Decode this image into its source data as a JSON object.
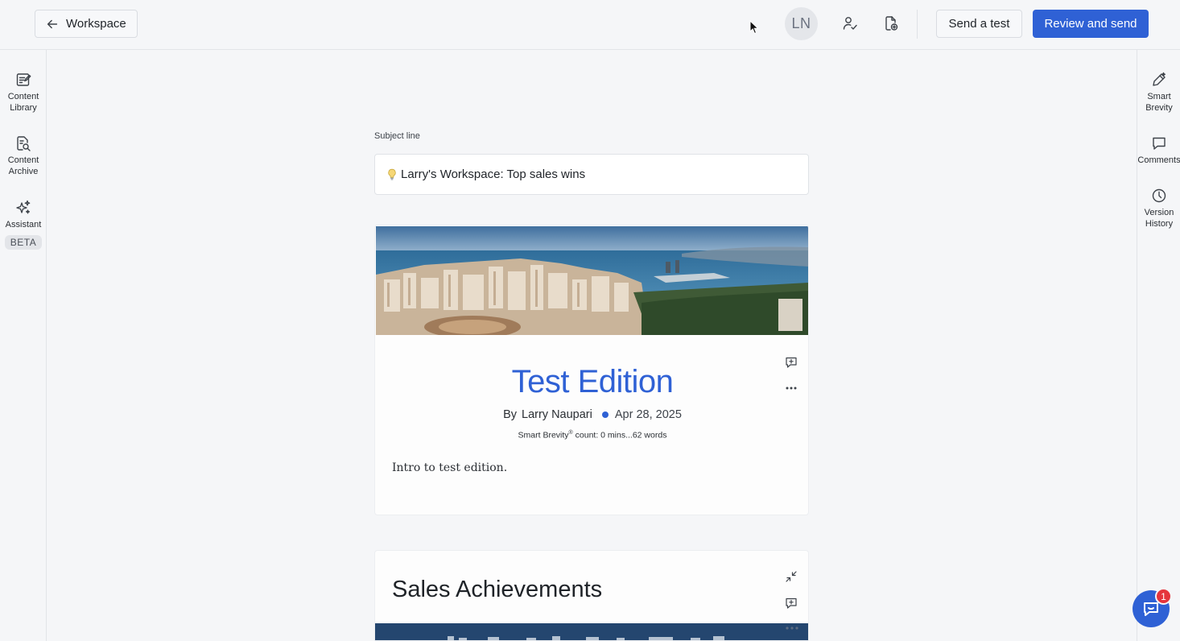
{
  "topbar": {
    "back_label": "Workspace",
    "avatar_initials": "LN",
    "send_test_label": "Send a test",
    "review_send_label": "Review and send"
  },
  "left_sidebar": {
    "items": [
      {
        "label_line1": "Content",
        "label_line2": "Library",
        "icon": "content-library-icon"
      },
      {
        "label_line1": "Content",
        "label_line2": "Archive",
        "icon": "content-archive-icon"
      },
      {
        "label_line1": "Assistant",
        "badge": "BETA",
        "icon": "sparkle-icon"
      }
    ]
  },
  "right_sidebar": {
    "items": [
      {
        "label_line1": "Smart",
        "label_line2": "Brevity",
        "icon": "pen-icon"
      },
      {
        "label_line1": "Comments",
        "icon": "comment-icon"
      },
      {
        "label_line1": "Version",
        "label_line2": "History",
        "icon": "clock-icon"
      }
    ]
  },
  "editor": {
    "subject_label": "Subject line",
    "subject_value": "Larry's Workspace: Top sales wins",
    "edition": {
      "title": "Test Edition",
      "by": "By",
      "author": "Larry Naupari",
      "date": "Apr 28, 2025",
      "brevity_prefix": "Smart Brevity",
      "brevity_mark": "®",
      "brevity_suffix": " count: 0 mins...62 words",
      "intro": "Intro to test edition."
    },
    "section": {
      "title": "Sales Achievements"
    }
  },
  "help_widget": {
    "badge_count": "1"
  },
  "colors": {
    "accent": "#2f61d5",
    "badge": "#e5343c"
  }
}
